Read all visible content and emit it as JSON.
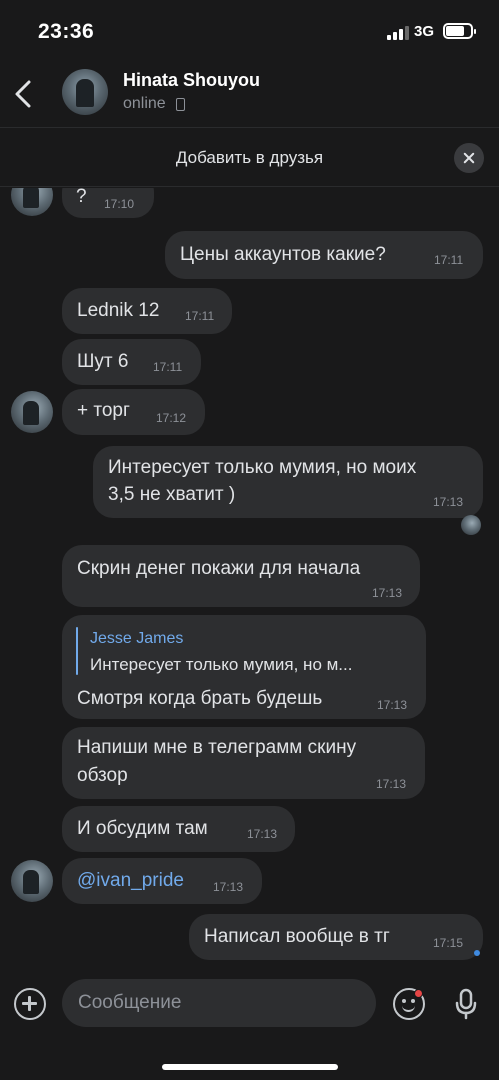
{
  "status_bar": {
    "time": "23:36",
    "network": "3G"
  },
  "header": {
    "name": "Hinata Shouyou",
    "status": "online"
  },
  "friend_bar": {
    "label": "Добавить в друзья"
  },
  "messages": [
    {
      "text": "?",
      "time": "17:10",
      "side": "incoming"
    },
    {
      "text": "Цены аккаунтов какие?",
      "time": "17:11",
      "side": "outgoing"
    },
    {
      "text": "Lednik 12",
      "time": "17:11",
      "side": "incoming"
    },
    {
      "text": "Шут 6",
      "time": "17:11",
      "side": "incoming"
    },
    {
      "text": "+ торг",
      "time": "17:12",
      "side": "incoming"
    },
    {
      "line1": "Интересует только мумия, но моих",
      "line2": "3,5 не хватит )",
      "time": "17:13",
      "side": "outgoing"
    },
    {
      "text": "Скрин денег покажи для начала",
      "time": "17:13",
      "side": "incoming"
    },
    {
      "reply_name": "Jesse James",
      "reply_text": "Интересует только мумия, но м...",
      "text": "Смотря когда брать будешь",
      "time": "17:13",
      "side": "incoming"
    },
    {
      "line1": "Напиши мне в телеграмм скину",
      "line2": "обзор",
      "time": "17:13",
      "side": "incoming"
    },
    {
      "text": "И обсудим там",
      "time": "17:13",
      "side": "incoming"
    },
    {
      "text": "@ivan_pride",
      "time": "17:13",
      "side": "incoming"
    },
    {
      "text": "Написал вообще в тг",
      "time": "17:15",
      "side": "outgoing"
    }
  ],
  "input": {
    "placeholder": "Сообщение"
  },
  "icons": {
    "back": "chevron-left-icon",
    "close": "close-icon",
    "attach": "plus-circle-icon",
    "sticker": "smile-icon",
    "mic": "microphone-icon"
  },
  "colors": {
    "background": "#19191a",
    "bubble": "#2d2e30",
    "link": "#71aaeb",
    "secondary_text": "#8d9198"
  }
}
